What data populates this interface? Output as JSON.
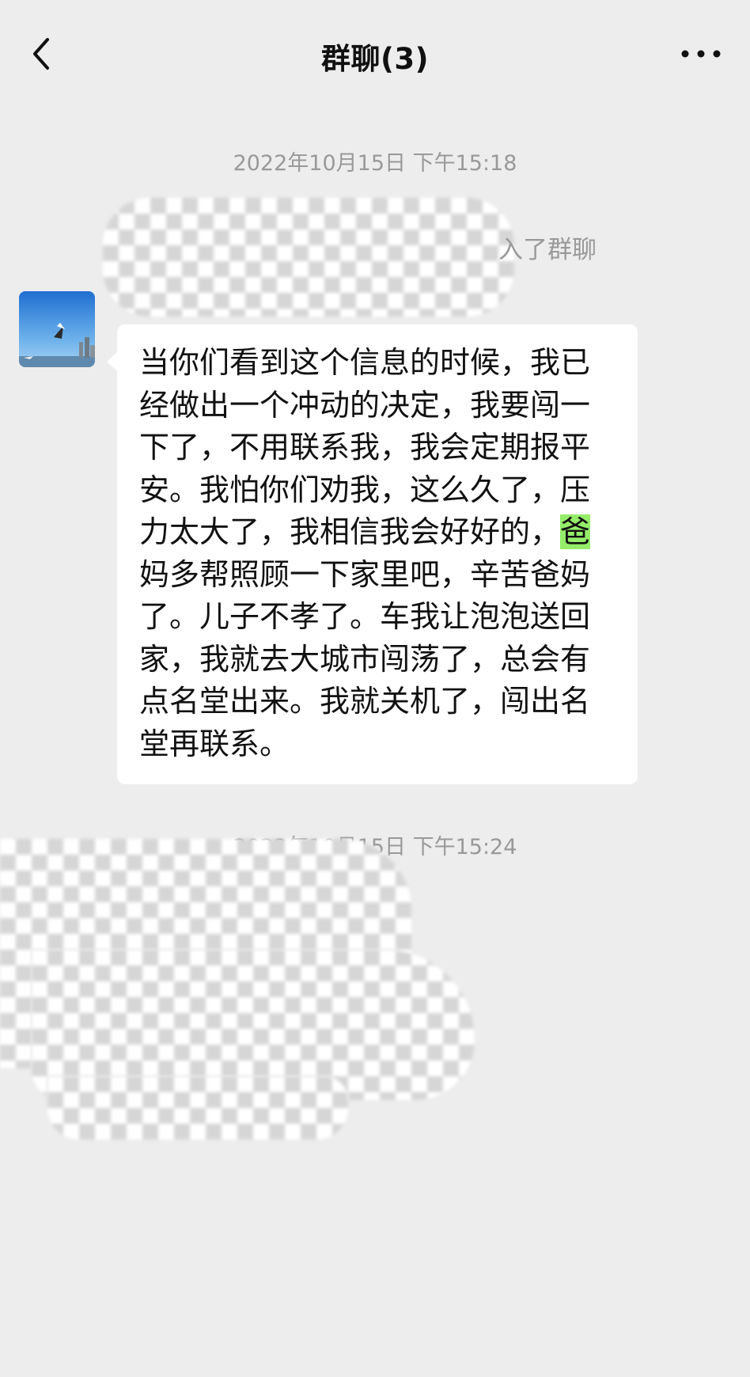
{
  "header": {
    "title": "群聊(3)",
    "back_icon": "chevron-left-icon",
    "more_icon": "ellipsis-icon"
  },
  "messages": [
    {
      "time": "2022年10月15日 下午15:18",
      "system_suffix": "入了群聊",
      "bubble": {
        "text_before": "当你们看到这个信息的时候，我已经做出一个冲动的决定，我要闯一下了，不用联系我，我会定期报平安。我怕你们劝我，这么久了，压力太大了，我相信我会好好的，",
        "highlight": "爸",
        "text_after": "妈多帮照顾一下家里吧，辛苦爸妈了。儿子不孝了。车我让泡泡送回家，我就去大城市闯荡了，总会有点名堂出来。我就关机了，闯出名堂再联系。"
      }
    },
    {
      "time": "2022年10月15日 下午15:24"
    }
  ],
  "colors": {
    "background": "#ededed",
    "bubble": "#ffffff",
    "highlight": "#95ec69",
    "timestamp": "#999999"
  }
}
